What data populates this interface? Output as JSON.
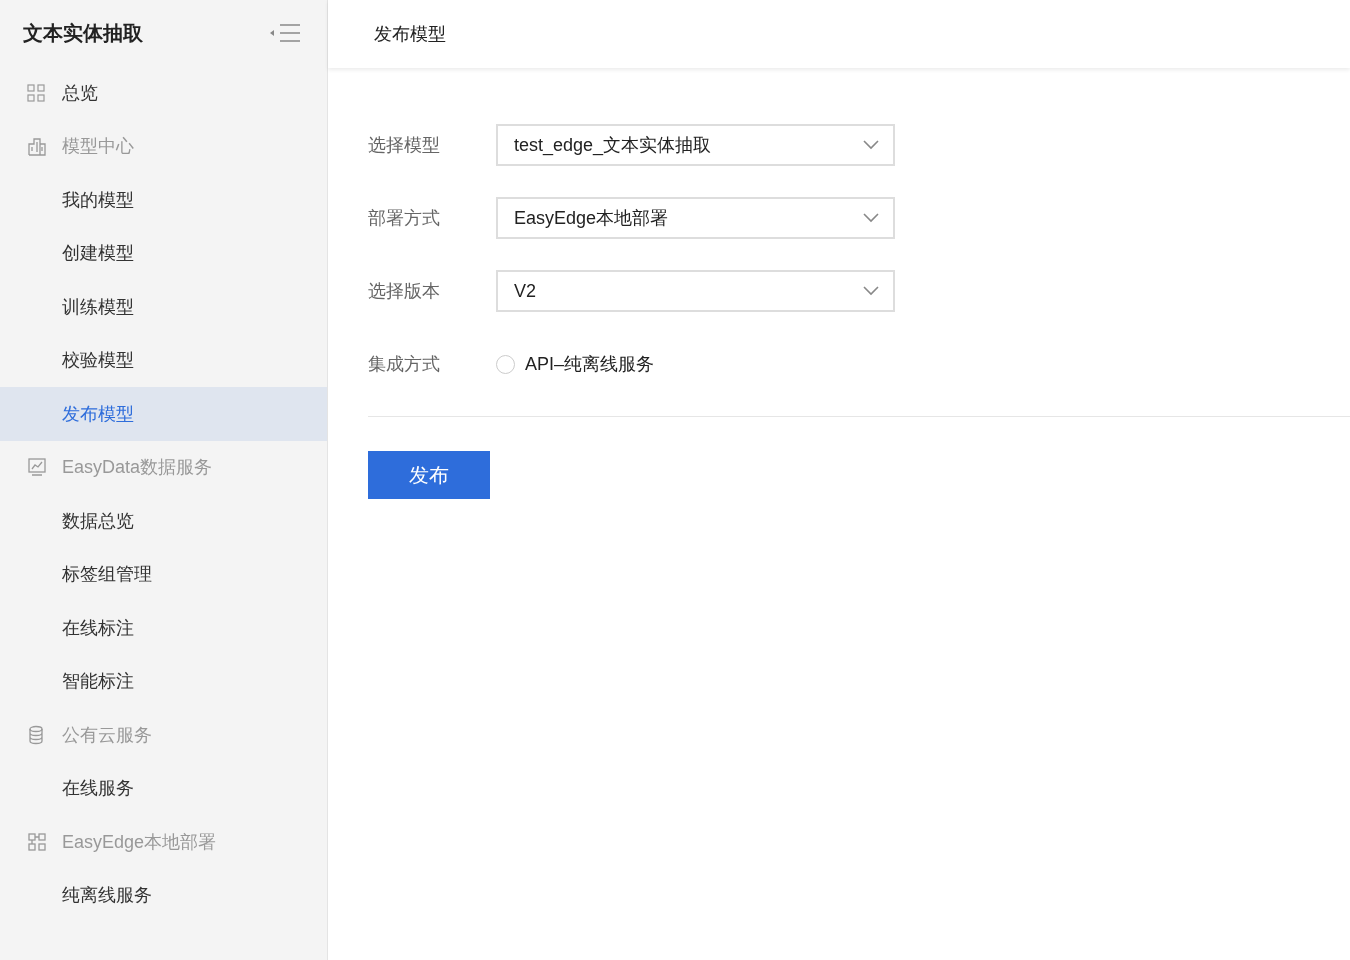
{
  "sidebar": {
    "title": "文本实体抽取",
    "nav": [
      {
        "kind": "link",
        "label": "总览",
        "selected": false
      },
      {
        "kind": "group",
        "label": "模型中心",
        "children": [
          {
            "label": "我的模型",
            "selected": false
          },
          {
            "label": "创建模型",
            "selected": false
          },
          {
            "label": "训练模型",
            "selected": false
          },
          {
            "label": "校验模型",
            "selected": false
          },
          {
            "label": "发布模型",
            "selected": true
          }
        ]
      },
      {
        "kind": "group",
        "label": "EasyData数据服务",
        "children": [
          {
            "label": "数据总览",
            "selected": false
          },
          {
            "label": "标签组管理",
            "selected": false
          },
          {
            "label": "在线标注",
            "selected": false
          },
          {
            "label": "智能标注",
            "selected": false
          }
        ]
      },
      {
        "kind": "group",
        "label": "公有云服务",
        "children": [
          {
            "label": "在线服务",
            "selected": false
          }
        ]
      },
      {
        "kind": "group",
        "label": "EasyEdge本地部署",
        "children": [
          {
            "label": "纯离线服务",
            "selected": false
          }
        ]
      }
    ]
  },
  "header": {
    "title": "发布模型"
  },
  "form": {
    "fields": [
      {
        "kind": "select",
        "label": "选择模型",
        "value": "test_edge_文本实体抽取"
      },
      {
        "kind": "select",
        "label": "部署方式",
        "value": "EasyEdge本地部署"
      },
      {
        "kind": "select",
        "label": "选择版本",
        "value": "V2"
      },
      {
        "kind": "radio",
        "label": "集成方式",
        "options": [
          {
            "label": "API–纯离线服务",
            "selected": false
          }
        ]
      }
    ],
    "submit": "发布"
  }
}
